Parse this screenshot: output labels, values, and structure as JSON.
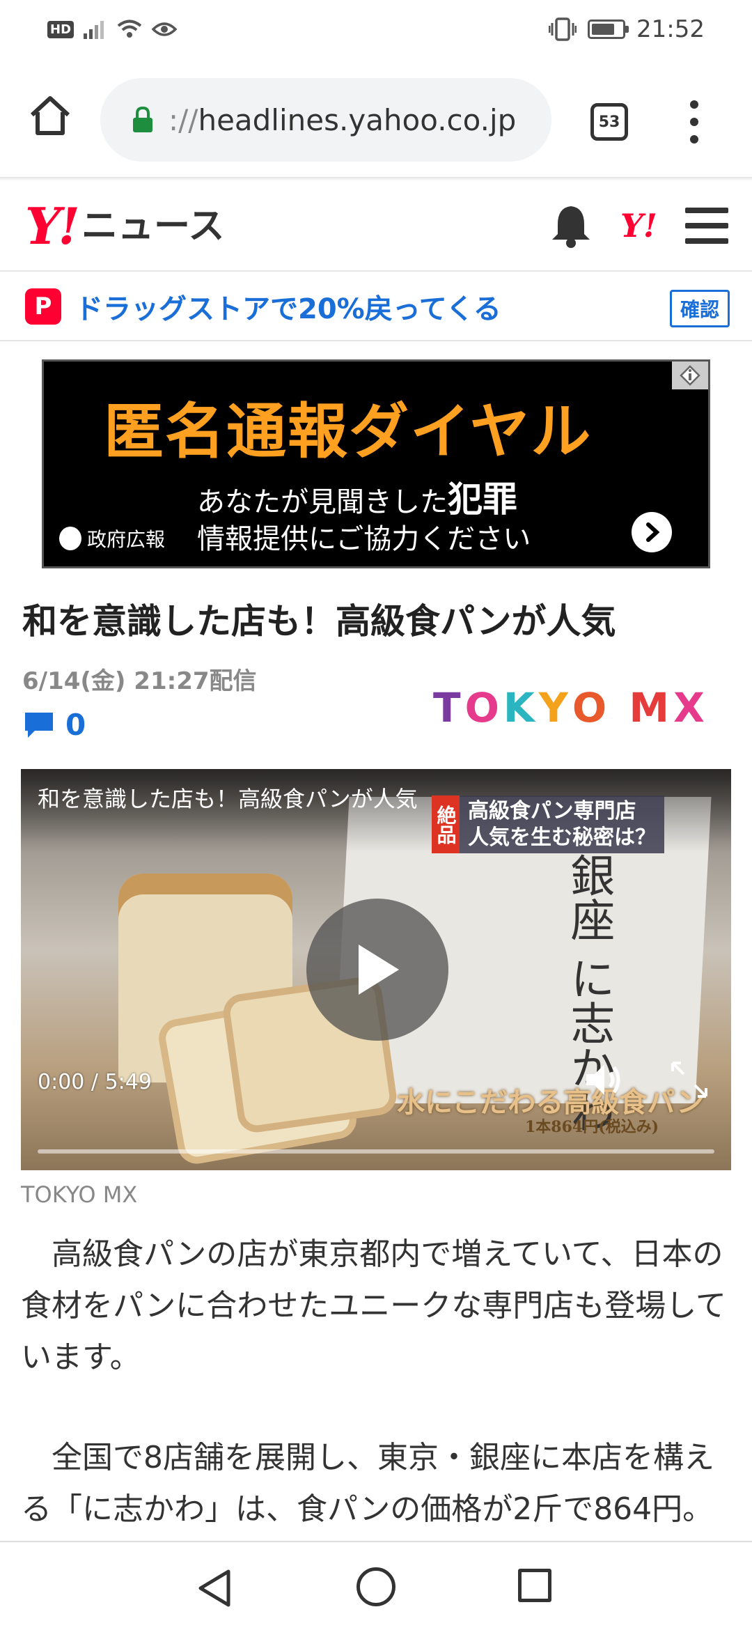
{
  "status_bar": {
    "hd_label": "HD",
    "time": "21:52"
  },
  "browser": {
    "url_scheme": "://",
    "url_host": "headlines.yahoo.co.jp",
    "tab_count": "53"
  },
  "site": {
    "logo_mark": "Y!",
    "logo_text": "ニュース",
    "header_logo_mark": "Y!"
  },
  "promo": {
    "icon_letter": "P",
    "text": "ドラッグストアで20%戻ってくる",
    "confirm_label": "確認"
  },
  "ad": {
    "headline": "匿名通報ダイヤル",
    "line1_prefix": "あなたが見聞きした",
    "line1_emphasis": "犯罪",
    "line2": "情報提供にご協力ください",
    "sponsor": "政府広報"
  },
  "article": {
    "title": "和を意識した店も！高級食パンが人気",
    "date": "6/14(金) 21:27配信",
    "comment_count": "0",
    "source_logo": {
      "letters": [
        "T",
        "O",
        "K",
        "Y",
        "O",
        " ",
        "M",
        "X"
      ],
      "colors": [
        "#7b3aa0",
        "#e63b8c",
        "#2bb5c0",
        "#f4a21b",
        "#e85a2b",
        "",
        "#e63b3b",
        "#e63b8c"
      ]
    },
    "video": {
      "title": "和を意識した店も！高級食パンが人気",
      "caption_tag": "絶品",
      "caption_line1": "高級食パン専門店",
      "caption_line2": "人気を生む秘密は？",
      "box_text": "銀座 に志かわ",
      "subtitle": "水にこだわる高級食パン",
      "price_text": "1本864円(税込み)",
      "current_time": "0:00",
      "separator": "/",
      "duration": "5:49",
      "progress": 0
    },
    "video_credit": "TOKYO MX",
    "paragraphs": [
      "　高級食パンの店が東京都内で増えていて、日本の食材をパンに合わせたユニークな専門店も登場しています。",
      "　全国で8店舗を展開し、東京・銀座に本店を構える「に志かわ」は、食パンの価格が2斤で864円。「高級」ともいえる価格ですが、形も大"
    ]
  },
  "colors": {
    "yahoo_red": "#ff0033",
    "link_blue": "#1a6ed8",
    "ad_orange": "#ffa020"
  }
}
